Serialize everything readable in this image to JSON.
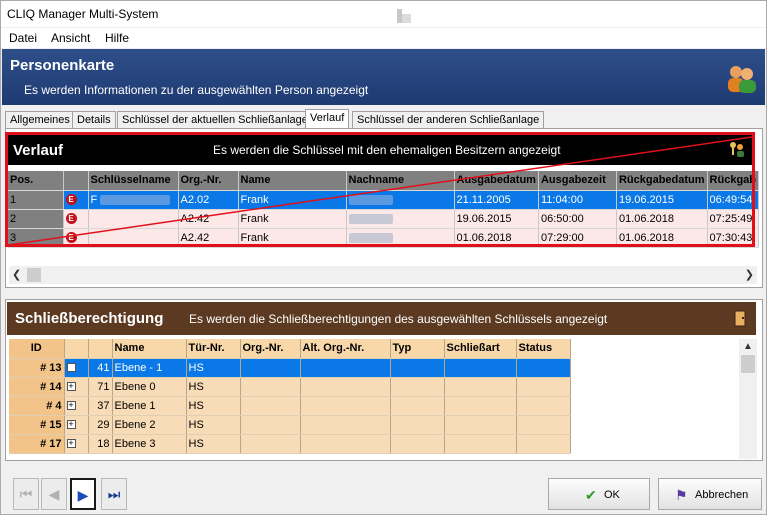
{
  "window": {
    "title": "CLIQ Manager Multi-System"
  },
  "menu": [
    "Datei",
    "Ansicht",
    "Hilfe"
  ],
  "header": {
    "title": "Personenkarte",
    "subtitle": "Es werden Informationen zu der ausgewählten Person angezeigt"
  },
  "tabs": [
    "Allgemeines",
    "Details",
    "Schlüssel der aktuellen Schließanlage",
    "Verlauf",
    "Schlüssel der anderen Schließanlage"
  ],
  "active_tab": "Verlauf",
  "verlauf": {
    "title": "Verlauf",
    "subtitle": "Es werden die Schlüssel mit den ehemaligen Besitzern angezeigt",
    "columns": [
      "Pos.",
      "",
      "Schlüsselname",
      "Org.-Nr.",
      "Name",
      "Nachname",
      "Ausgabedatum",
      "Ausgabezeit",
      "Rückgabedatum",
      "Rückgab"
    ],
    "rows": [
      {
        "pos": "1",
        "badge": "E",
        "key": "F",
        "org": "A2.02",
        "name": "Frank",
        "ausgabedatum": "21.11.2005",
        "ausgabezeit": "11:04:00",
        "rueckgabedatum": "19.06.2015",
        "rueckgabezeit": "06:49:54"
      },
      {
        "pos": "2",
        "badge": "E",
        "key": "",
        "org": "A2.42",
        "name": "Frank",
        "ausgabedatum": "19.06.2015",
        "ausgabezeit": "06:50:00",
        "rueckgabedatum": "01.06.2018",
        "rueckgabezeit": "07:25:49"
      },
      {
        "pos": "3",
        "badge": "E",
        "key": "",
        "org": "A2.42",
        "name": "Frank",
        "ausgabedatum": "01.06.2018",
        "ausgabezeit": "07:29:00",
        "rueckgabedatum": "01.06.2018",
        "rueckgabezeit": "07:30:43"
      }
    ]
  },
  "schliess": {
    "title": "Schließberechtigung",
    "subtitle": "Es werden die Schließberechtigungen des ausgewählten Schlüssels angezeigt",
    "columns": [
      "ID",
      "",
      "",
      "Name",
      "Tür-Nr.",
      "Org.-Nr.",
      "Alt. Org.-Nr.",
      "Typ",
      "Schließart",
      "Status"
    ],
    "rows": [
      {
        "id": "# 13",
        "expander": "",
        "num": "41",
        "name": "Ebene - 1",
        "tuer": "HS"
      },
      {
        "id": "# 14",
        "expander": "+",
        "num": "71",
        "name": "Ebene 0",
        "tuer": "HS"
      },
      {
        "id": "# 4",
        "expander": "+",
        "num": "37",
        "name": "Ebene 1",
        "tuer": "HS"
      },
      {
        "id": "# 15",
        "expander": "+",
        "num": "29",
        "name": "Ebene 2",
        "tuer": "HS"
      },
      {
        "id": "# 17",
        "expander": "+",
        "num": "18",
        "name": "Ebene 3",
        "tuer": "HS"
      }
    ]
  },
  "buttons": {
    "ok": "OK",
    "cancel": "Abbrechen"
  }
}
